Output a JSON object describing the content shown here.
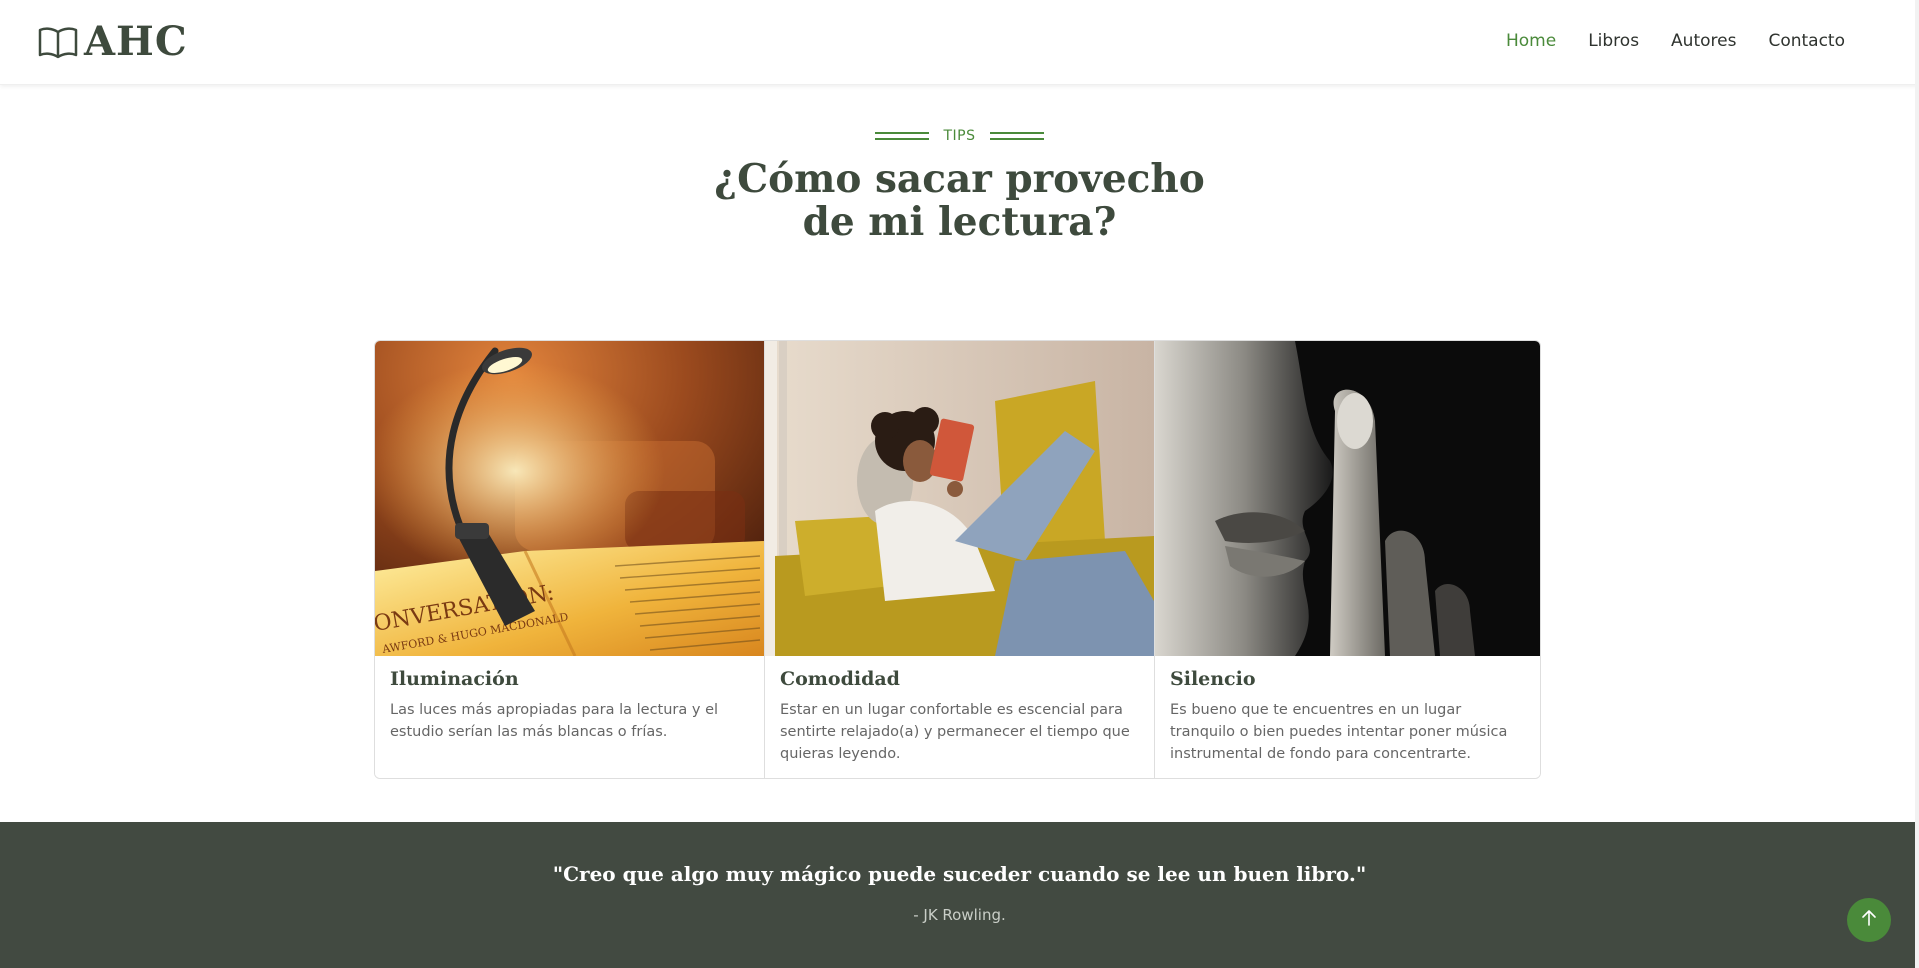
{
  "brand": {
    "name": "AHC",
    "icon": "open-book-icon"
  },
  "nav": {
    "items": [
      {
        "label": "Home",
        "active": true
      },
      {
        "label": "Libros",
        "active": false
      },
      {
        "label": "Autores",
        "active": false
      },
      {
        "label": "Contacto",
        "active": false
      }
    ]
  },
  "section": {
    "kicker": "TIPS",
    "title_line1": "¿Cómo sacar provecho",
    "title_line2": "de mi lectura?"
  },
  "cards": [
    {
      "title": "Iluminación",
      "text": "Las luces más apropiadas para la lectura y el estudio serían las más blancas o frías.",
      "image": "reading-lamp-on-open-book",
      "book_caption_1": "ONVERSATION:",
      "book_caption_2": "AWFORD & HUGO MACDONALD"
    },
    {
      "title": "Comodidad",
      "text": "Estar en un lugar confortable es escencial para sentirte relajado(a) y permanecer el tiempo que quieras leyendo.",
      "image": "woman-reading-on-yellow-sofa"
    },
    {
      "title": "Silencio",
      "text": "Es bueno que te encuentres en un lugar tranquilo o bien puedes intentar poner música instrumental de fondo para concentrarte.",
      "image": "finger-on-lips-silence"
    }
  ],
  "quote": {
    "text": "\"Creo que algo muy mágico puede suceder cuando se lee un buen libro.\"",
    "author": "- JK Rowling."
  },
  "back_to_top": {
    "icon": "arrow-up-icon"
  },
  "colors": {
    "accent": "#4a8a3a",
    "dark": "#424a41",
    "heading": "#3e4a3d"
  }
}
